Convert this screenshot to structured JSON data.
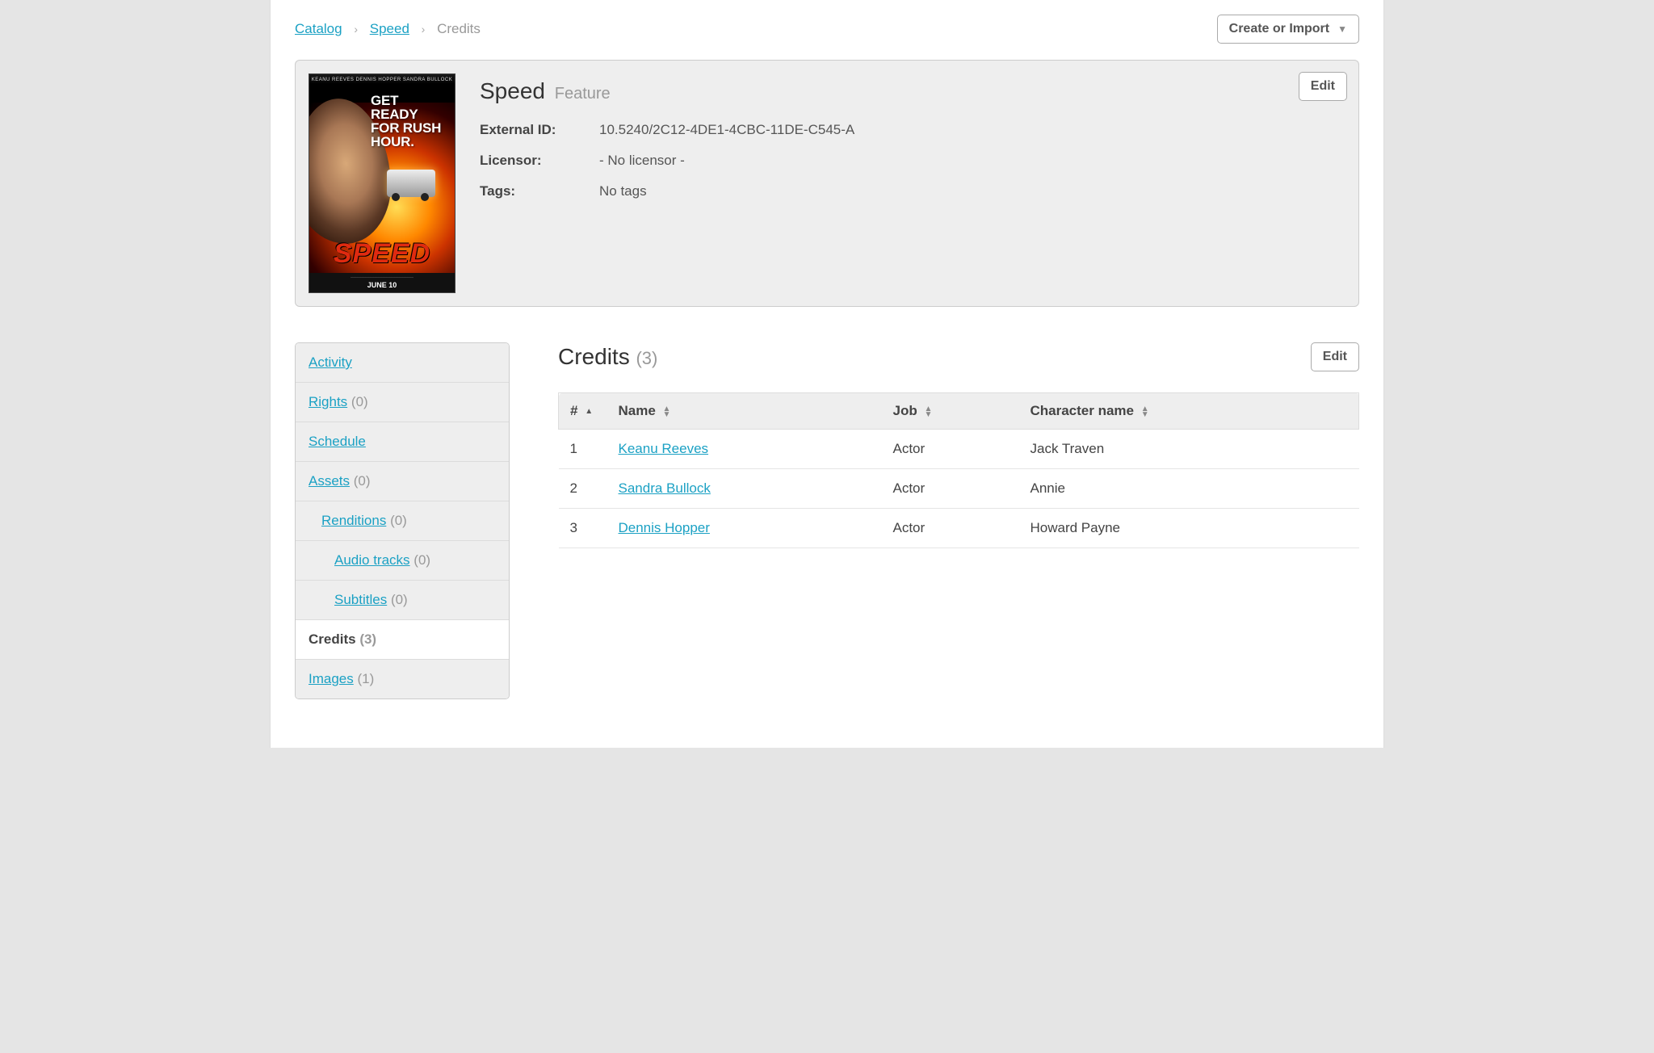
{
  "breadcrumb": {
    "items": [
      {
        "label": "Catalog",
        "link": true
      },
      {
        "label": "Speed",
        "link": true
      },
      {
        "label": "Credits",
        "link": false
      }
    ],
    "sep": "›"
  },
  "create_button": "Create or Import",
  "summary": {
    "title": "Speed",
    "subtype": "Feature",
    "edit_button": "Edit",
    "poster": {
      "top_credits": "KEANU REEVES   DENNIS HOPPER   SANDRA BULLOCK",
      "tagline": "GET READY FOR RUSH HOUR.",
      "title": "SPEED",
      "date": "JUNE 10"
    },
    "meta": [
      {
        "label": "External ID:",
        "value": "10.5240/2C12-4DE1-4CBC-11DE-C545-A"
      },
      {
        "label": "Licensor:",
        "value": "- No licensor -"
      },
      {
        "label": "Tags:",
        "value": "No tags"
      }
    ]
  },
  "sidebar": [
    {
      "label": "Activity",
      "count": "",
      "link": true,
      "indent": 0,
      "active": false
    },
    {
      "label": "Rights",
      "count": "(0)",
      "link": true,
      "indent": 0,
      "active": false
    },
    {
      "label": "Schedule",
      "count": "",
      "link": true,
      "indent": 0,
      "active": false
    },
    {
      "label": "Assets",
      "count": "(0)",
      "link": true,
      "indent": 0,
      "active": false
    },
    {
      "label": "Renditions",
      "count": "(0)",
      "link": true,
      "indent": 1,
      "active": false
    },
    {
      "label": "Audio tracks",
      "count": "(0)",
      "link": true,
      "indent": 2,
      "active": false
    },
    {
      "label": "Subtitles",
      "count": "(0)",
      "link": true,
      "indent": 2,
      "active": false
    },
    {
      "label": "Credits",
      "count": "(3)",
      "link": false,
      "indent": 0,
      "active": true
    },
    {
      "label": "Images",
      "count": "(1)",
      "link": true,
      "indent": 0,
      "active": false
    }
  ],
  "credits": {
    "title": "Credits",
    "count": "(3)",
    "edit_button": "Edit",
    "columns": {
      "num": "#",
      "name": "Name",
      "job": "Job",
      "character": "Character name"
    },
    "rows": [
      {
        "num": "1",
        "name": "Keanu Reeves",
        "job": "Actor",
        "character": "Jack Traven"
      },
      {
        "num": "2",
        "name": "Sandra Bullock",
        "job": "Actor",
        "character": "Annie"
      },
      {
        "num": "3",
        "name": "Dennis Hopper",
        "job": "Actor",
        "character": "Howard Payne"
      }
    ]
  }
}
